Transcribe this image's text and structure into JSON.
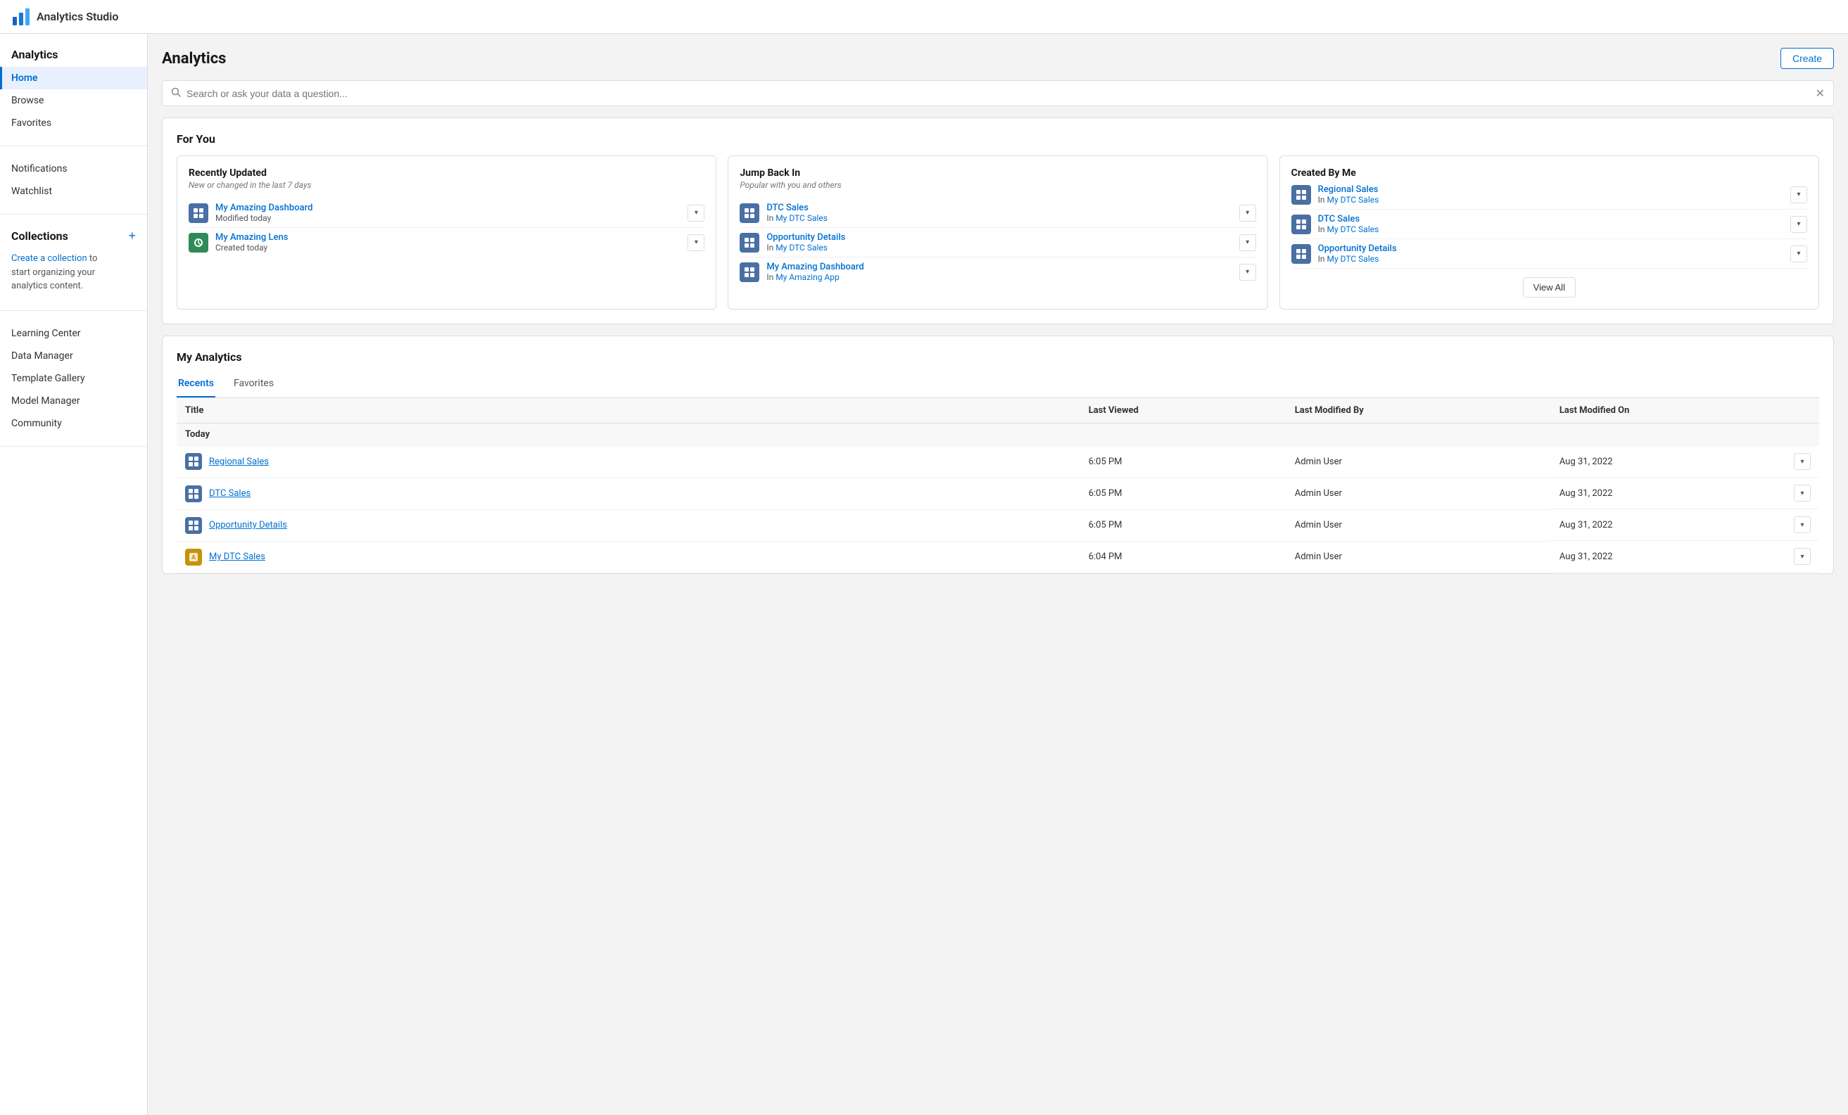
{
  "header": {
    "app_title": "Analytics Studio",
    "logo_alt": "analytics-studio-logo"
  },
  "sidebar": {
    "sections": [
      {
        "id": "analytics",
        "title": "Analytics",
        "items": [
          {
            "id": "home",
            "label": "Home",
            "active": true
          },
          {
            "id": "browse",
            "label": "Browse",
            "active": false
          },
          {
            "id": "favorites",
            "label": "Favorites",
            "active": false
          }
        ]
      },
      {
        "id": "notifications_group",
        "title": null,
        "items": [
          {
            "id": "notifications",
            "label": "Notifications",
            "active": false
          },
          {
            "id": "watchlist",
            "label": "Watchlist",
            "active": false
          }
        ]
      },
      {
        "id": "collections",
        "title": "Collections",
        "has_add": true,
        "add_label": "+",
        "description_prefix": "Create a collection",
        "description_link": "Create a collection",
        "description_suffix": " to\nstart organizing your\nanalytics content."
      },
      {
        "id": "tools",
        "title": null,
        "items": [
          {
            "id": "learning_center",
            "label": "Learning Center",
            "active": false
          },
          {
            "id": "data_manager",
            "label": "Data Manager",
            "active": false
          },
          {
            "id": "template_gallery",
            "label": "Template Gallery",
            "active": false
          },
          {
            "id": "model_manager",
            "label": "Model Manager",
            "active": false
          },
          {
            "id": "community",
            "label": "Community",
            "active": false
          }
        ]
      }
    ]
  },
  "content": {
    "page_title": "Analytics",
    "create_button": "Create",
    "search_placeholder": "Search or ask your data a question...",
    "for_you": {
      "section_title": "For You",
      "recently_updated": {
        "title": "Recently Updated",
        "subtitle": "New or changed in the last 7 days",
        "items": [
          {
            "name": "My Amazing Dashboard",
            "meta": "Modified today",
            "icon_type": "blue",
            "meta_link": null
          },
          {
            "name": "My Amazing Lens",
            "meta": "Created today",
            "icon_type": "green",
            "meta_link": null
          }
        ]
      },
      "jump_back_in": {
        "title": "Jump Back In",
        "subtitle": "Popular with you and others",
        "items": [
          {
            "name": "DTC Sales",
            "meta_prefix": "In ",
            "meta_link": "My DTC Sales",
            "icon_type": "blue"
          },
          {
            "name": "Opportunity Details",
            "meta_prefix": "In ",
            "meta_link": "My DTC Sales",
            "icon_type": "blue"
          },
          {
            "name": "My Amazing Dashboard",
            "meta_prefix": "In ",
            "meta_link": "My Amazing App",
            "icon_type": "blue"
          }
        ]
      },
      "created_by_me": {
        "title": "Created By Me",
        "items": [
          {
            "name": "Regional Sales",
            "meta_prefix": "In ",
            "meta_link": "My DTC Sales",
            "icon_type": "blue"
          },
          {
            "name": "DTC Sales",
            "meta_prefix": "In ",
            "meta_link": "My DTC Sales",
            "icon_type": "blue"
          },
          {
            "name": "Opportunity Details",
            "meta_prefix": "In ",
            "meta_link": "My DTC Sales",
            "icon_type": "blue"
          }
        ],
        "view_all": "View All"
      }
    },
    "my_analytics": {
      "section_title": "My Analytics",
      "tabs": [
        {
          "id": "recents",
          "label": "Recents",
          "active": true
        },
        {
          "id": "favorites",
          "label": "Favorites",
          "active": false
        }
      ],
      "table": {
        "columns": [
          "Title",
          "Last Viewed",
          "Last Modified By",
          "Last Modified On"
        ],
        "groups": [
          {
            "group_label": "Today",
            "rows": [
              {
                "name": "Regional Sales",
                "icon_type": "blue",
                "last_viewed": "6:05 PM",
                "last_modified_by": "Admin User",
                "last_modified_on": "Aug 31, 2022"
              },
              {
                "name": "DTC Sales",
                "icon_type": "blue",
                "last_viewed": "6:05 PM",
                "last_modified_by": "Admin User",
                "last_modified_on": "Aug 31, 2022"
              },
              {
                "name": "Opportunity Details",
                "icon_type": "blue",
                "last_viewed": "6:05 PM",
                "last_modified_by": "Admin User",
                "last_modified_on": "Aug 31, 2022"
              },
              {
                "name": "My DTC Sales",
                "icon_type": "gold",
                "last_viewed": "6:04 PM",
                "last_modified_by": "Admin User",
                "last_modified_on": "Aug 31, 2022"
              }
            ]
          }
        ]
      }
    }
  },
  "colors": {
    "blue_icon": "#4a6fa5",
    "green_icon": "#2e8b57",
    "gold_icon": "#c8910a",
    "accent": "#0070d2",
    "active_nav": "#e8f0fe"
  }
}
